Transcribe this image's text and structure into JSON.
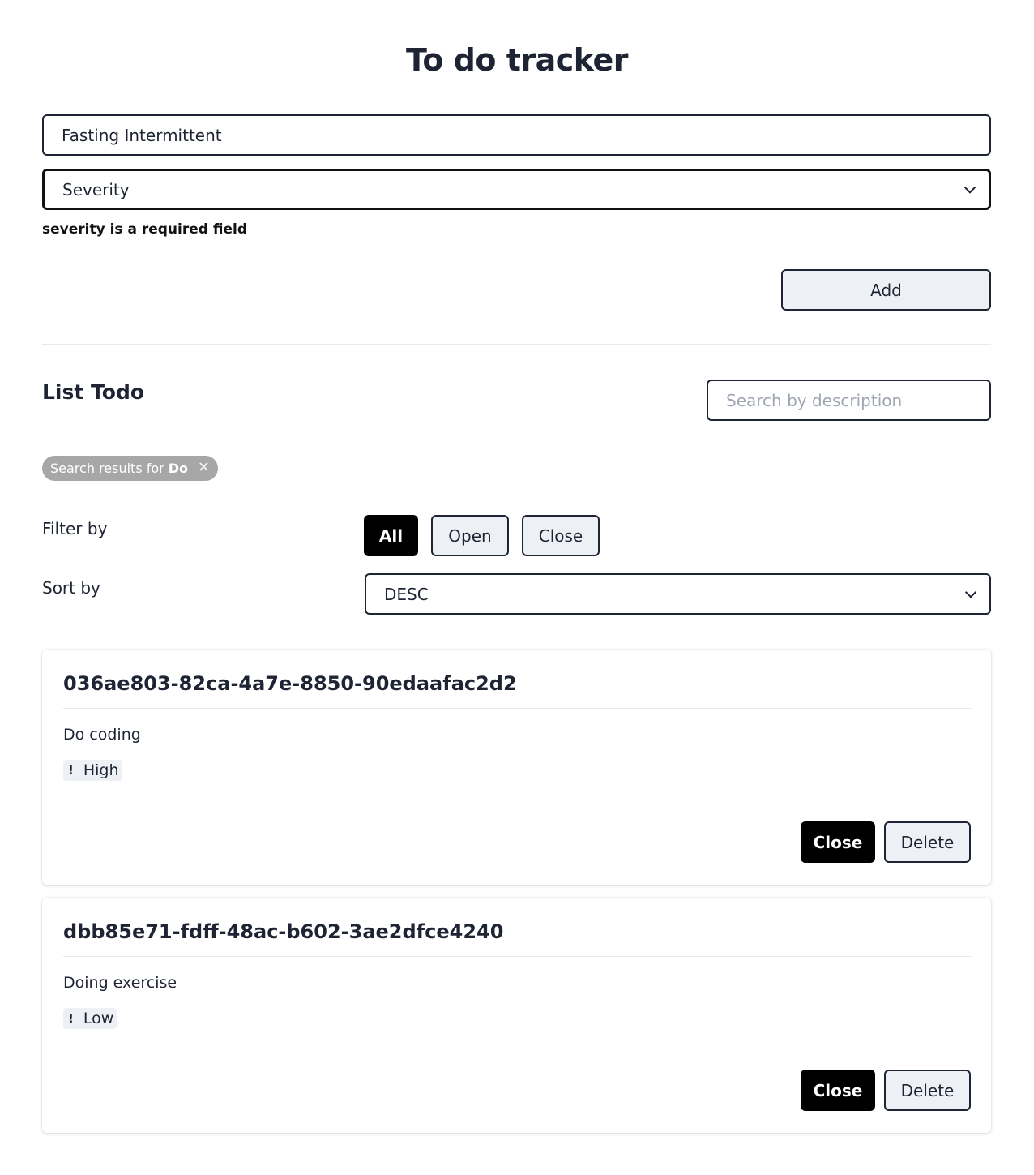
{
  "app": {
    "title": "To do tracker"
  },
  "form": {
    "description_value": "Fasting Intermittent",
    "severity_value": "Severity",
    "error_message": "severity is a required field",
    "add_label": "Add"
  },
  "list": {
    "title": "List Todo",
    "search_placeholder": "Search by description",
    "search_chip": {
      "prefix": "Search results for",
      "term": "Do",
      "close_glyph": "✕"
    },
    "filter": {
      "label": "Filter by",
      "options": [
        "All",
        "Open",
        "Close"
      ],
      "selected": "All"
    },
    "sort": {
      "label": "Sort by",
      "value": "DESC"
    },
    "items": [
      {
        "id": "036ae803-82ca-4a7e-8850-90edaafac2d2",
        "description": "Do coding",
        "severity": "High",
        "severity_icon": "!",
        "close_label": "Close",
        "delete_label": "Delete"
      },
      {
        "id": "dbb85e71-fdff-48ac-b602-3ae2dfce4240",
        "description": "Doing exercise",
        "severity": "Low",
        "severity_icon": "!",
        "close_label": "Close",
        "delete_label": "Delete"
      }
    ]
  }
}
